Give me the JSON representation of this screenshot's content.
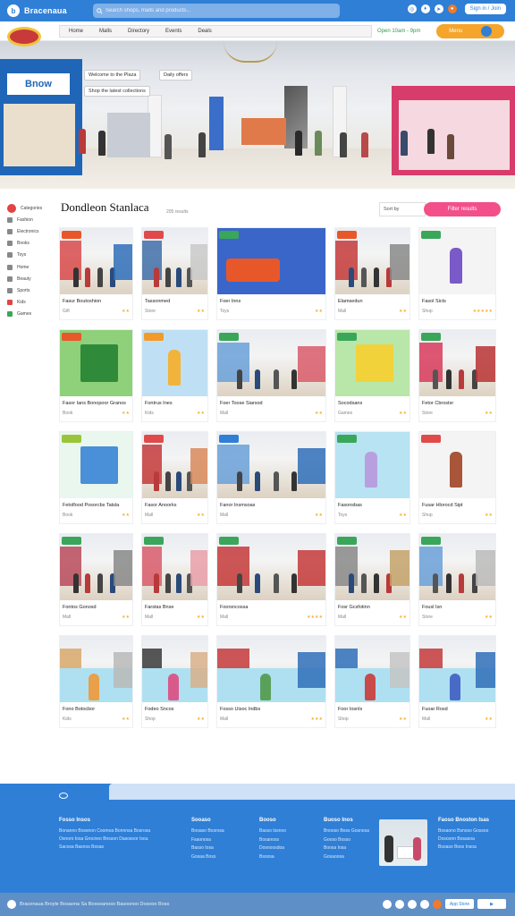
{
  "topbar": {
    "brand": "Bracenaua",
    "search_placeholder": "Search shops, malls and products...",
    "signin_label": "Sign in / Join"
  },
  "nav": {
    "items": [
      "Home",
      "Malls",
      "Directory",
      "Events",
      "Deals"
    ],
    "right_text": "Open 10am - 9pm",
    "pill_label": "Menu"
  },
  "hero": {
    "store_sign": "Bnow",
    "tags": [
      "Welcome to the Plaza",
      "Daily offers",
      "Shop the latest collections"
    ]
  },
  "sidebar": {
    "items": [
      "Categories",
      "Fashion",
      "Electronics",
      "Books",
      "Toys",
      "Home",
      "Beauty",
      "Sports",
      "Kids",
      "Games"
    ]
  },
  "content": {
    "title": "Dondleon Stanlaca",
    "subtitle": "205 results",
    "filter_label": "Sort by",
    "filter_button": "Filter results"
  },
  "cards": [
    {
      "title": "Fasur Boutoshion",
      "meta": "Gift",
      "stars": "★★",
      "thumb": "mall",
      "badge": "#e8572a",
      "shop": "#d84a4a",
      "shop2": "#2f6fb8"
    },
    {
      "title": "Tassonmed",
      "meta": "Store",
      "stars": "★★",
      "thumb": "mall",
      "badge": "#e04a4a",
      "shop": "#3f6fa8",
      "shop2": "#c9c9c9"
    },
    {
      "title": "Foer Inns",
      "meta": "Toys",
      "stars": "★★",
      "thumb": "toy-bus",
      "badge": "#3aa65a"
    },
    {
      "title": "Elamsedun",
      "meta": "Mall",
      "stars": "★★",
      "thumb": "mall",
      "badge": "#e8572a",
      "shop": "#c43a3a",
      "shop2": "#888"
    },
    {
      "title": "Fasol Sicts",
      "meta": "Shop",
      "stars": "★★★★★",
      "thumb": "cartoon-seller",
      "badge": "#3aa65a"
    },
    {
      "title": "Fasor Ians Bonopoor Granos",
      "meta": "Book",
      "stars": "★★",
      "thumb": "board-book",
      "badge": "#e8572a"
    },
    {
      "title": "Fontrus Ines",
      "meta": "Kids",
      "stars": "★★",
      "thumb": "cartoon-family",
      "badge": "#f29b2a"
    },
    {
      "title": "Foer Toose Siarsod",
      "meta": "Mall",
      "stars": "★★",
      "thumb": "mall-night",
      "badge": "#3aa65a"
    },
    {
      "title": "Socodsans",
      "meta": "Games",
      "stars": "★★",
      "thumb": "game-box",
      "badge": "#3aa65a"
    },
    {
      "title": "Fetor Cbrostsr",
      "meta": "Store",
      "stars": "★★",
      "thumb": "mall",
      "badge": "#3aa65a",
      "shop": "#d83a5a",
      "shop2": "#b83232"
    },
    {
      "title": "Fetolfood Posorcbs Tatsla",
      "meta": "Book",
      "stars": "★★",
      "thumb": "kids-book",
      "badge": "#9ac43a"
    },
    {
      "title": "Fasor Anoorks",
      "meta": "Mall",
      "stars": "★★",
      "thumb": "mall",
      "badge": "#e04a4a",
      "shop": "#c43a3a",
      "shop2": "#d88a5a"
    },
    {
      "title": "Fanor Insmsoas",
      "meta": "Mall",
      "stars": "★★",
      "thumb": "mall",
      "badge": "#2f7fd6",
      "shop": "#6aa0d8",
      "shop2": "#2f6fb8"
    },
    {
      "title": "Fasonsbas",
      "meta": "Toys",
      "stars": "★★",
      "thumb": "cartoon-pair",
      "badge": "#3aa65a"
    },
    {
      "title": "Fusar Hlorocd Sipt",
      "meta": "Shop",
      "stars": "★★",
      "thumb": "shopper",
      "badge": "#e04a4a"
    },
    {
      "title": "Fontos Gonosd",
      "meta": "Mall",
      "stars": "★★",
      "thumb": "mall-people",
      "badge": "#3aa65a",
      "shop": "#b84a5a",
      "shop2": "#888"
    },
    {
      "title": "Farstas Bnse",
      "meta": "Mall",
      "stars": "★★",
      "thumb": "mall-display",
      "badge": "#3aa65a",
      "shop": "#d85a6a",
      "shop2": "#e8a0a8"
    },
    {
      "title": "Foorsncossa",
      "meta": "Mall",
      "stars": "★★★★",
      "thumb": "mall-corridor",
      "badge": "#3aa65a",
      "shop": "#c43a3a",
      "shop2": "#c43a3a"
    },
    {
      "title": "Fosr Gcsfotinn",
      "meta": "Mall",
      "stars": "★★",
      "thumb": "mall",
      "badge": "#3aa65a",
      "shop": "#888",
      "shop2": "#c4a26a"
    },
    {
      "title": "Fousl Isn",
      "meta": "Store",
      "stars": "★★",
      "thumb": "mall-coat",
      "badge": "#3aa65a",
      "shop": "#6aa0d8",
      "shop2": "#bbb"
    },
    {
      "title": "Fono Botocbor",
      "meta": "Kids",
      "stars": "★★",
      "thumb": "mall-toys",
      "badge": "",
      "shop": "#d8a86a",
      "shop2": "#b8b8b8"
    },
    {
      "title": "Fodeo Sncos",
      "meta": "Shop",
      "stars": "★★",
      "thumb": "mall-toys2",
      "badge": "",
      "shop": "#3a3a3a",
      "shop2": "#d8b08a"
    },
    {
      "title": "Fosso Uisoc Indbs",
      "meta": "Mall",
      "stars": "★★★",
      "thumb": "mall-toys3",
      "badge": "",
      "shop": "#c43a3a",
      "shop2": "#2f6fb8"
    },
    {
      "title": "Foor Iosnls",
      "meta": "Shop",
      "stars": "★★",
      "thumb": "mall-toys4",
      "badge": "",
      "shop": "#2f6fb8",
      "shop2": "#c4c4c4"
    },
    {
      "title": "Fuoar Rosd",
      "meta": "Mall",
      "stars": "★★",
      "thumb": "mall-toys5",
      "badge": "",
      "shop": "#c43a3a",
      "shop2": "#2f6fb8"
    }
  ],
  "footer": {
    "columns": [
      {
        "title": "Fosso Insos",
        "lines": [
          "Bonanno Bossnon Coomoa Bonnnsa Bosrosa",
          "Osnoro Iosa Grocneo Bnsson Dasosoor Isou",
          "Sacosa Basnos Bosas"
        ]
      },
      {
        "title": "Sooaso",
        "links": [
          "Booaso Bosrosa",
          "Fsaonosa",
          "Basso Iosa",
          "Gosaa Boss"
        ]
      },
      {
        "title": "Booso",
        "links": [
          "Basso Issnoo",
          "Bosanoss",
          "Dosnoosdoa",
          "Bsoosa"
        ]
      },
      {
        "title": "Buoso Inos",
        "links": [
          "Bnooso Boss Gosnosa",
          "Gooso Bosso",
          "Boosa Iosa",
          "Gosaoosa"
        ]
      },
      {
        "title": "Faoso Bnoston Isas",
        "lines": [
          "Bosaono Bsnoso Gossoo",
          "Dosoonn Bosasoa",
          "Bsoaso Boss Insoa"
        ]
      }
    ]
  },
  "bottombar": {
    "text": "Bracenaua Broyle   Bosaona Sa Bossoanoso Basosnoo Dosooo Boss",
    "store_label": "App Store"
  }
}
